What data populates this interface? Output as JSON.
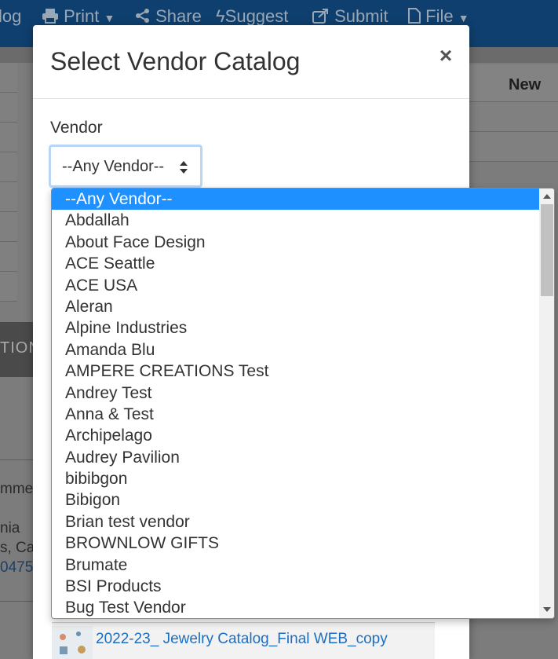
{
  "toolbar": {
    "items": [
      {
        "label": "log",
        "icon": "none"
      },
      {
        "label": "Print",
        "icon": "printer-icon"
      },
      {
        "label": "Share",
        "icon": "share-icon"
      },
      {
        "label": "Suggest",
        "icon": "lightning-icon"
      },
      {
        "label": "Submit",
        "icon": "submit-icon"
      },
      {
        "label": "File",
        "icon": "file-icon"
      }
    ]
  },
  "background": {
    "table_header_new": "New",
    "band_text": "TIONS",
    "left_texts": [
      "mmen",
      "nia",
      "s, Ca",
      "0475"
    ]
  },
  "modal": {
    "title": "Select Vendor Catalog",
    "close_label": "×",
    "vendor_label": "Vendor",
    "vendor_selected": "--Any Vendor--",
    "file_row_name": "2022-23_ Jewelry Catalog_Final WEB_copy"
  },
  "dropdown": {
    "options": [
      "--Any Vendor--",
      "Abdallah",
      "About Face Design",
      "ACE Seattle",
      "ACE USA",
      "Aleran",
      "Alpine Industries",
      "Amanda Blu",
      "AMPERE CREATIONS Test",
      "Andrey Test",
      "Anna & Test",
      "Archipelago",
      "Audrey Pavilion",
      "bibibgon",
      "Bibigon",
      "Brian test vendor",
      "BROWNLOW GIFTS",
      "Brumate",
      "BSI Products",
      "Bug Test Vendor"
    ],
    "selected_index": 0
  },
  "colors": {
    "highlight": "#1e90ff",
    "topbar": "#1b6cc0",
    "focus_ring": "#b9d6f7",
    "link": "#1a6fc4"
  }
}
